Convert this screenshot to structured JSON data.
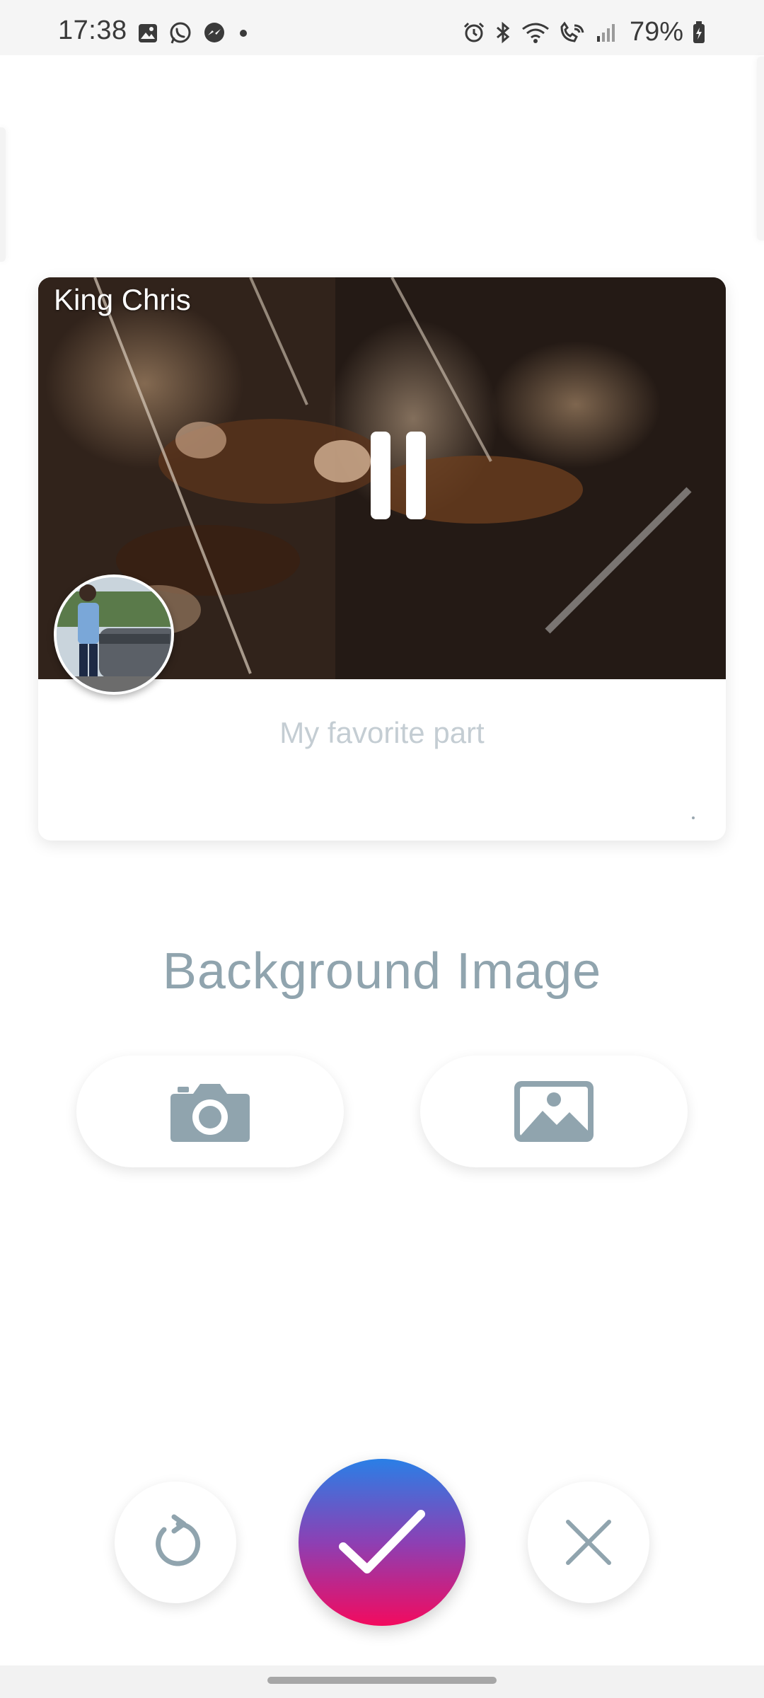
{
  "status_bar": {
    "time": "17:38",
    "battery": "79%",
    "left_icons": [
      "gallery-icon",
      "whatsapp-icon",
      "messenger-icon",
      "dot-icon"
    ],
    "right_icons": [
      "alarm-icon",
      "bluetooth-icon",
      "wifi-icon",
      "wifi-call-icon",
      "signal-icon",
      "battery-icon"
    ]
  },
  "card": {
    "author": "King Chris",
    "caption_placeholder": "My favorite part",
    "media_state": "playing",
    "media_description_icon": "pause-icon"
  },
  "background_section": {
    "title": "Background Image",
    "camera_icon": "camera-icon",
    "gallery_icon": "image-icon"
  },
  "actions": {
    "reset_icon": "refresh-icon",
    "confirm_icon": "checkmark-icon",
    "close_icon": "close-icon"
  },
  "colors": {
    "accent_muted": "#90a4ae",
    "confirm_gradient_top": "#2a7fe6",
    "confirm_gradient_bottom": "#f30a5e",
    "placeholder_text": "#c4cdd3"
  }
}
